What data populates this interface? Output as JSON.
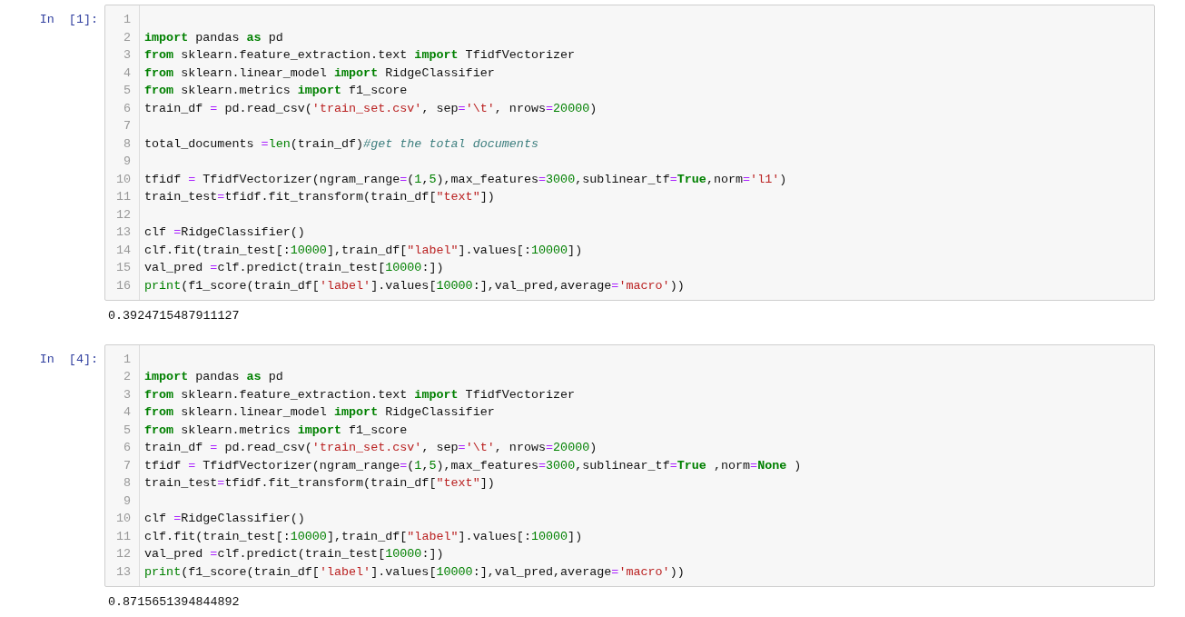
{
  "cells": [
    {
      "prompt": "In  [1]:",
      "lines": [
        {
          "number": "1"
        },
        {
          "number": "2",
          "tokens": [
            {
              "kind": "keyword",
              "text": "import"
            },
            {
              "kind": "plain",
              "text": " pandas "
            },
            {
              "kind": "keyword",
              "text": "as"
            },
            {
              "kind": "plain",
              "text": " pd"
            }
          ]
        },
        {
          "number": "3",
          "tokens": [
            {
              "kind": "keyword",
              "text": "from"
            },
            {
              "kind": "plain",
              "text": " sklearn.feature_extraction.text "
            },
            {
              "kind": "keyword",
              "text": "import"
            },
            {
              "kind": "plain",
              "text": " TfidfVectorizer"
            }
          ]
        },
        {
          "number": "4",
          "tokens": [
            {
              "kind": "keyword",
              "text": "from"
            },
            {
              "kind": "plain",
              "text": " sklearn.linear_model "
            },
            {
              "kind": "keyword",
              "text": "import"
            },
            {
              "kind": "plain",
              "text": " RidgeClassifier"
            }
          ]
        },
        {
          "number": "5",
          "tokens": [
            {
              "kind": "keyword",
              "text": "from"
            },
            {
              "kind": "plain",
              "text": " sklearn.metrics "
            },
            {
              "kind": "keyword",
              "text": "import"
            },
            {
              "kind": "plain",
              "text": " f1_score"
            }
          ]
        },
        {
          "number": "6",
          "tokens": [
            {
              "kind": "plain",
              "text": "train_df "
            },
            {
              "kind": "operator",
              "text": "="
            },
            {
              "kind": "plain",
              "text": " pd.read_csv("
            },
            {
              "kind": "string",
              "text": "'train_set.csv'"
            },
            {
              "kind": "plain",
              "text": ", sep"
            },
            {
              "kind": "operator",
              "text": "="
            },
            {
              "kind": "string",
              "text": "'\\t'"
            },
            {
              "kind": "plain",
              "text": ", nrows"
            },
            {
              "kind": "operator",
              "text": "="
            },
            {
              "kind": "number",
              "text": "20000"
            },
            {
              "kind": "plain",
              "text": ")"
            }
          ]
        },
        {
          "number": "7"
        },
        {
          "number": "8",
          "tokens": [
            {
              "kind": "plain",
              "text": "total_documents "
            },
            {
              "kind": "operator",
              "text": "="
            },
            {
              "kind": "builtin",
              "text": "len"
            },
            {
              "kind": "plain",
              "text": "(train_df)"
            },
            {
              "kind": "comment",
              "text": "#get the total documents"
            }
          ]
        },
        {
          "number": "9"
        },
        {
          "number": "10",
          "tokens": [
            {
              "kind": "plain",
              "text": "tfidf "
            },
            {
              "kind": "operator",
              "text": "="
            },
            {
              "kind": "plain",
              "text": " TfidfVectorizer(ngram_range"
            },
            {
              "kind": "operator",
              "text": "="
            },
            {
              "kind": "plain",
              "text": "("
            },
            {
              "kind": "number",
              "text": "1"
            },
            {
              "kind": "plain",
              "text": ","
            },
            {
              "kind": "number",
              "text": "5"
            },
            {
              "kind": "plain",
              "text": "),max_features"
            },
            {
              "kind": "operator",
              "text": "="
            },
            {
              "kind": "number",
              "text": "3000"
            },
            {
              "kind": "plain",
              "text": ",sublinear_tf"
            },
            {
              "kind": "operator",
              "text": "="
            },
            {
              "kind": "keyword",
              "text": "True"
            },
            {
              "kind": "plain",
              "text": ",norm"
            },
            {
              "kind": "operator",
              "text": "="
            },
            {
              "kind": "string",
              "text": "'l1'"
            },
            {
              "kind": "plain",
              "text": ")"
            }
          ]
        },
        {
          "number": "11",
          "tokens": [
            {
              "kind": "plain",
              "text": "train_test"
            },
            {
              "kind": "operator",
              "text": "="
            },
            {
              "kind": "plain",
              "text": "tfidf.fit_transform(train_df["
            },
            {
              "kind": "string",
              "text": "\"text\""
            },
            {
              "kind": "plain",
              "text": "])"
            }
          ]
        },
        {
          "number": "12"
        },
        {
          "number": "13",
          "tokens": [
            {
              "kind": "plain",
              "text": "clf "
            },
            {
              "kind": "operator",
              "text": "="
            },
            {
              "kind": "plain",
              "text": "RidgeClassifier()"
            }
          ]
        },
        {
          "number": "14",
          "tokens": [
            {
              "kind": "plain",
              "text": "clf.fit(train_test[:"
            },
            {
              "kind": "number",
              "text": "10000"
            },
            {
              "kind": "plain",
              "text": "],train_df["
            },
            {
              "kind": "string",
              "text": "\"label\""
            },
            {
              "kind": "plain",
              "text": "].values[:"
            },
            {
              "kind": "number",
              "text": "10000"
            },
            {
              "kind": "plain",
              "text": "])"
            }
          ]
        },
        {
          "number": "15",
          "tokens": [
            {
              "kind": "plain",
              "text": "val_pred "
            },
            {
              "kind": "operator",
              "text": "="
            },
            {
              "kind": "plain",
              "text": "clf.predict(train_test["
            },
            {
              "kind": "number",
              "text": "10000"
            },
            {
              "kind": "plain",
              "text": ":])"
            }
          ]
        },
        {
          "number": "16",
          "tokens": [
            {
              "kind": "builtin",
              "text": "print"
            },
            {
              "kind": "plain",
              "text": "(f1_score(train_df["
            },
            {
              "kind": "string",
              "text": "'label'"
            },
            {
              "kind": "plain",
              "text": "].values["
            },
            {
              "kind": "number",
              "text": "10000"
            },
            {
              "kind": "plain",
              "text": ":],val_pred,average"
            },
            {
              "kind": "operator",
              "text": "="
            },
            {
              "kind": "string",
              "text": "'macro'"
            },
            {
              "kind": "plain",
              "text": "))"
            }
          ]
        }
      ],
      "output": "0.3924715487911127"
    },
    {
      "prompt": "In  [4]:",
      "lines": [
        {
          "number": "1"
        },
        {
          "number": "2",
          "tokens": [
            {
              "kind": "keyword",
              "text": "import"
            },
            {
              "kind": "plain",
              "text": " pandas "
            },
            {
              "kind": "keyword",
              "text": "as"
            },
            {
              "kind": "plain",
              "text": " pd"
            }
          ]
        },
        {
          "number": "3",
          "tokens": [
            {
              "kind": "keyword",
              "text": "from"
            },
            {
              "kind": "plain",
              "text": " sklearn.feature_extraction.text "
            },
            {
              "kind": "keyword",
              "text": "import"
            },
            {
              "kind": "plain",
              "text": " TfidfVectorizer"
            }
          ]
        },
        {
          "number": "4",
          "tokens": [
            {
              "kind": "keyword",
              "text": "from"
            },
            {
              "kind": "plain",
              "text": " sklearn.linear_model "
            },
            {
              "kind": "keyword",
              "text": "import"
            },
            {
              "kind": "plain",
              "text": " RidgeClassifier"
            }
          ]
        },
        {
          "number": "5",
          "tokens": [
            {
              "kind": "keyword",
              "text": "from"
            },
            {
              "kind": "plain",
              "text": " sklearn.metrics "
            },
            {
              "kind": "keyword",
              "text": "import"
            },
            {
              "kind": "plain",
              "text": " f1_score"
            }
          ]
        },
        {
          "number": "6",
          "tokens": [
            {
              "kind": "plain",
              "text": "train_df "
            },
            {
              "kind": "operator",
              "text": "="
            },
            {
              "kind": "plain",
              "text": " pd.read_csv("
            },
            {
              "kind": "string",
              "text": "'train_set.csv'"
            },
            {
              "kind": "plain",
              "text": ", sep"
            },
            {
              "kind": "operator",
              "text": "="
            },
            {
              "kind": "string",
              "text": "'\\t'"
            },
            {
              "kind": "plain",
              "text": ", nrows"
            },
            {
              "kind": "operator",
              "text": "="
            },
            {
              "kind": "number",
              "text": "20000"
            },
            {
              "kind": "plain",
              "text": ")"
            }
          ]
        },
        {
          "number": "7",
          "tokens": [
            {
              "kind": "plain",
              "text": "tfidf "
            },
            {
              "kind": "operator",
              "text": "="
            },
            {
              "kind": "plain",
              "text": " TfidfVectorizer(ngram_range"
            },
            {
              "kind": "operator",
              "text": "="
            },
            {
              "kind": "plain",
              "text": "("
            },
            {
              "kind": "number",
              "text": "1"
            },
            {
              "kind": "plain",
              "text": ","
            },
            {
              "kind": "number",
              "text": "5"
            },
            {
              "kind": "plain",
              "text": "),max_features"
            },
            {
              "kind": "operator",
              "text": "="
            },
            {
              "kind": "number",
              "text": "3000"
            },
            {
              "kind": "plain",
              "text": ",sublinear_tf"
            },
            {
              "kind": "operator",
              "text": "="
            },
            {
              "kind": "keyword",
              "text": "True"
            },
            {
              "kind": "plain",
              "text": " ,norm"
            },
            {
              "kind": "operator",
              "text": "="
            },
            {
              "kind": "keyword",
              "text": "None"
            },
            {
              "kind": "plain",
              "text": " )"
            }
          ]
        },
        {
          "number": "8",
          "tokens": [
            {
              "kind": "plain",
              "text": "train_test"
            },
            {
              "kind": "operator",
              "text": "="
            },
            {
              "kind": "plain",
              "text": "tfidf.fit_transform(train_df["
            },
            {
              "kind": "string",
              "text": "\"text\""
            },
            {
              "kind": "plain",
              "text": "])"
            }
          ]
        },
        {
          "number": "9"
        },
        {
          "number": "10",
          "tokens": [
            {
              "kind": "plain",
              "text": "clf "
            },
            {
              "kind": "operator",
              "text": "="
            },
            {
              "kind": "plain",
              "text": "RidgeClassifier()"
            }
          ]
        },
        {
          "number": "11",
          "tokens": [
            {
              "kind": "plain",
              "text": "clf.fit(train_test[:"
            },
            {
              "kind": "number",
              "text": "10000"
            },
            {
              "kind": "plain",
              "text": "],train_df["
            },
            {
              "kind": "string",
              "text": "\"label\""
            },
            {
              "kind": "plain",
              "text": "].values[:"
            },
            {
              "kind": "number",
              "text": "10000"
            },
            {
              "kind": "plain",
              "text": "])"
            }
          ]
        },
        {
          "number": "12",
          "tokens": [
            {
              "kind": "plain",
              "text": "val_pred "
            },
            {
              "kind": "operator",
              "text": "="
            },
            {
              "kind": "plain",
              "text": "clf.predict(train_test["
            },
            {
              "kind": "number",
              "text": "10000"
            },
            {
              "kind": "plain",
              "text": ":])"
            }
          ]
        },
        {
          "number": "13",
          "tokens": [
            {
              "kind": "builtin",
              "text": "print"
            },
            {
              "kind": "plain",
              "text": "(f1_score(train_df["
            },
            {
              "kind": "string",
              "text": "'label'"
            },
            {
              "kind": "plain",
              "text": "].values["
            },
            {
              "kind": "number",
              "text": "10000"
            },
            {
              "kind": "plain",
              "text": ":],val_pred,average"
            },
            {
              "kind": "operator",
              "text": "="
            },
            {
              "kind": "string",
              "text": "'macro'"
            },
            {
              "kind": "plain",
              "text": "))"
            }
          ]
        }
      ],
      "output": "0.8715651394844892"
    }
  ]
}
